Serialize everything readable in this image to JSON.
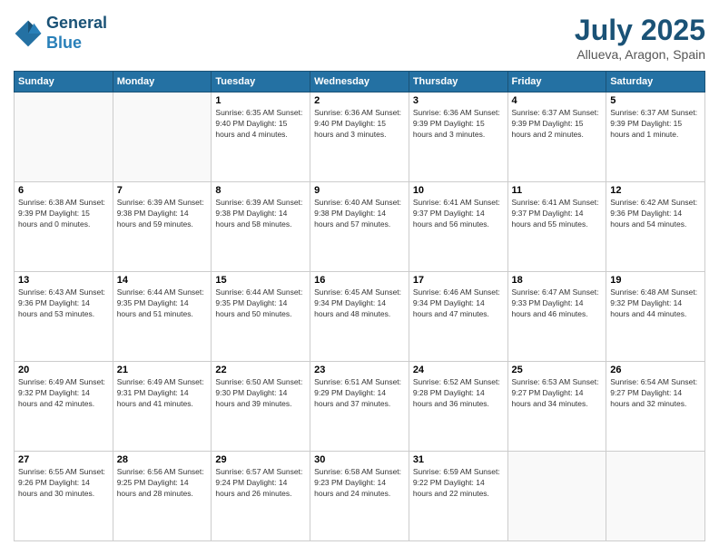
{
  "header": {
    "logo_line1": "General",
    "logo_line2": "Blue",
    "month": "July 2025",
    "location": "Allueva, Aragon, Spain"
  },
  "weekdays": [
    "Sunday",
    "Monday",
    "Tuesday",
    "Wednesday",
    "Thursday",
    "Friday",
    "Saturday"
  ],
  "weeks": [
    [
      {
        "day": "",
        "info": ""
      },
      {
        "day": "",
        "info": ""
      },
      {
        "day": "1",
        "info": "Sunrise: 6:35 AM\nSunset: 9:40 PM\nDaylight: 15 hours\nand 4 minutes."
      },
      {
        "day": "2",
        "info": "Sunrise: 6:36 AM\nSunset: 9:40 PM\nDaylight: 15 hours\nand 3 minutes."
      },
      {
        "day": "3",
        "info": "Sunrise: 6:36 AM\nSunset: 9:39 PM\nDaylight: 15 hours\nand 3 minutes."
      },
      {
        "day": "4",
        "info": "Sunrise: 6:37 AM\nSunset: 9:39 PM\nDaylight: 15 hours\nand 2 minutes."
      },
      {
        "day": "5",
        "info": "Sunrise: 6:37 AM\nSunset: 9:39 PM\nDaylight: 15 hours\nand 1 minute."
      }
    ],
    [
      {
        "day": "6",
        "info": "Sunrise: 6:38 AM\nSunset: 9:39 PM\nDaylight: 15 hours\nand 0 minutes."
      },
      {
        "day": "7",
        "info": "Sunrise: 6:39 AM\nSunset: 9:38 PM\nDaylight: 14 hours\nand 59 minutes."
      },
      {
        "day": "8",
        "info": "Sunrise: 6:39 AM\nSunset: 9:38 PM\nDaylight: 14 hours\nand 58 minutes."
      },
      {
        "day": "9",
        "info": "Sunrise: 6:40 AM\nSunset: 9:38 PM\nDaylight: 14 hours\nand 57 minutes."
      },
      {
        "day": "10",
        "info": "Sunrise: 6:41 AM\nSunset: 9:37 PM\nDaylight: 14 hours\nand 56 minutes."
      },
      {
        "day": "11",
        "info": "Sunrise: 6:41 AM\nSunset: 9:37 PM\nDaylight: 14 hours\nand 55 minutes."
      },
      {
        "day": "12",
        "info": "Sunrise: 6:42 AM\nSunset: 9:36 PM\nDaylight: 14 hours\nand 54 minutes."
      }
    ],
    [
      {
        "day": "13",
        "info": "Sunrise: 6:43 AM\nSunset: 9:36 PM\nDaylight: 14 hours\nand 53 minutes."
      },
      {
        "day": "14",
        "info": "Sunrise: 6:44 AM\nSunset: 9:35 PM\nDaylight: 14 hours\nand 51 minutes."
      },
      {
        "day": "15",
        "info": "Sunrise: 6:44 AM\nSunset: 9:35 PM\nDaylight: 14 hours\nand 50 minutes."
      },
      {
        "day": "16",
        "info": "Sunrise: 6:45 AM\nSunset: 9:34 PM\nDaylight: 14 hours\nand 48 minutes."
      },
      {
        "day": "17",
        "info": "Sunrise: 6:46 AM\nSunset: 9:34 PM\nDaylight: 14 hours\nand 47 minutes."
      },
      {
        "day": "18",
        "info": "Sunrise: 6:47 AM\nSunset: 9:33 PM\nDaylight: 14 hours\nand 46 minutes."
      },
      {
        "day": "19",
        "info": "Sunrise: 6:48 AM\nSunset: 9:32 PM\nDaylight: 14 hours\nand 44 minutes."
      }
    ],
    [
      {
        "day": "20",
        "info": "Sunrise: 6:49 AM\nSunset: 9:32 PM\nDaylight: 14 hours\nand 42 minutes."
      },
      {
        "day": "21",
        "info": "Sunrise: 6:49 AM\nSunset: 9:31 PM\nDaylight: 14 hours\nand 41 minutes."
      },
      {
        "day": "22",
        "info": "Sunrise: 6:50 AM\nSunset: 9:30 PM\nDaylight: 14 hours\nand 39 minutes."
      },
      {
        "day": "23",
        "info": "Sunrise: 6:51 AM\nSunset: 9:29 PM\nDaylight: 14 hours\nand 37 minutes."
      },
      {
        "day": "24",
        "info": "Sunrise: 6:52 AM\nSunset: 9:28 PM\nDaylight: 14 hours\nand 36 minutes."
      },
      {
        "day": "25",
        "info": "Sunrise: 6:53 AM\nSunset: 9:27 PM\nDaylight: 14 hours\nand 34 minutes."
      },
      {
        "day": "26",
        "info": "Sunrise: 6:54 AM\nSunset: 9:27 PM\nDaylight: 14 hours\nand 32 minutes."
      }
    ],
    [
      {
        "day": "27",
        "info": "Sunrise: 6:55 AM\nSunset: 9:26 PM\nDaylight: 14 hours\nand 30 minutes."
      },
      {
        "day": "28",
        "info": "Sunrise: 6:56 AM\nSunset: 9:25 PM\nDaylight: 14 hours\nand 28 minutes."
      },
      {
        "day": "29",
        "info": "Sunrise: 6:57 AM\nSunset: 9:24 PM\nDaylight: 14 hours\nand 26 minutes."
      },
      {
        "day": "30",
        "info": "Sunrise: 6:58 AM\nSunset: 9:23 PM\nDaylight: 14 hours\nand 24 minutes."
      },
      {
        "day": "31",
        "info": "Sunrise: 6:59 AM\nSunset: 9:22 PM\nDaylight: 14 hours\nand 22 minutes."
      },
      {
        "day": "",
        "info": ""
      },
      {
        "day": "",
        "info": ""
      }
    ]
  ]
}
